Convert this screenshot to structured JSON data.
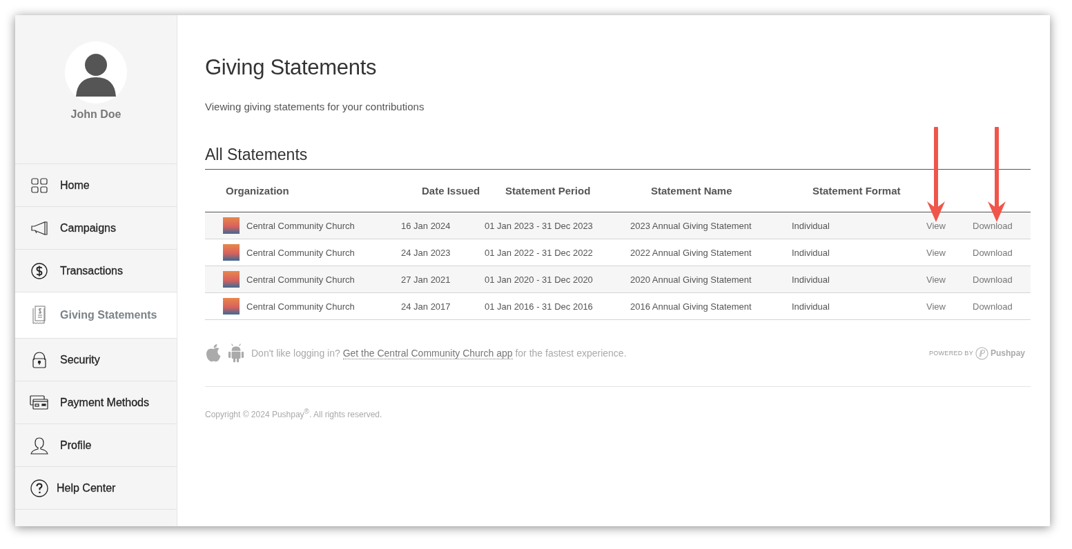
{
  "sidebar": {
    "user": {
      "name": "John Doe"
    },
    "items": [
      {
        "kind": "home",
        "label": "Home",
        "selected": false
      },
      {
        "kind": "megaphone",
        "label": "Campaigns",
        "selected": false
      },
      {
        "kind": "dollar",
        "label": "Transactions",
        "selected": false
      },
      {
        "kind": "receipt",
        "label": "Giving Statements",
        "selected": true
      },
      {
        "kind": "lock",
        "label": "Security",
        "selected": false
      },
      {
        "kind": "cards",
        "label": "Payment Methods",
        "selected": false
      },
      {
        "kind": "person",
        "label": "Profile",
        "selected": false
      },
      {
        "kind": "help",
        "label": "Help Center",
        "selected": false
      }
    ]
  },
  "page": {
    "title": "Giving Statements",
    "subtitle": "Viewing giving statements for your contributions"
  },
  "table": {
    "title": "All Statements",
    "columns": [
      "Organization",
      "Date Issued",
      "Statement Period",
      "Statement Name",
      "Statement Format"
    ],
    "rows": [
      {
        "organization": "Central Community Church",
        "date_issued": "16 Jan 2024",
        "period": "01 Jan 2023 - 31 Dec 2023",
        "name": "2023 Annual Giving Statement",
        "format": "Individual",
        "view": "View",
        "download": "Download"
      },
      {
        "organization": "Central Community Church",
        "date_issued": "24 Jan 2023",
        "period": "01 Jan 2022 - 31 Dec 2022",
        "name": "2022 Annual Giving Statement",
        "format": "Individual",
        "view": "View",
        "download": "Download"
      },
      {
        "organization": "Central Community Church",
        "date_issued": "27 Jan 2021",
        "period": "01 Jan 2020 - 31 Dec 2020",
        "name": "2020 Annual Giving Statement",
        "format": "Individual",
        "view": "View",
        "download": "Download"
      },
      {
        "organization": "Central Community Church",
        "date_issued": "24 Jan 2017",
        "period": "01 Jan 2016 - 31 Dec 2016",
        "name": "2016 Annual Giving Statement",
        "format": "Individual",
        "view": "View",
        "download": "Download"
      }
    ]
  },
  "app_promo": {
    "prefix": "Don't like logging in?",
    "link": "Get the Central Community Church app",
    "suffix": "for the fastest experience."
  },
  "powered_by": {
    "label": "POWERED BY",
    "brand": "Pushpay"
  },
  "copyright": "Copyright © 2024 Pushpay$^{®}$. All rights reserved."
}
